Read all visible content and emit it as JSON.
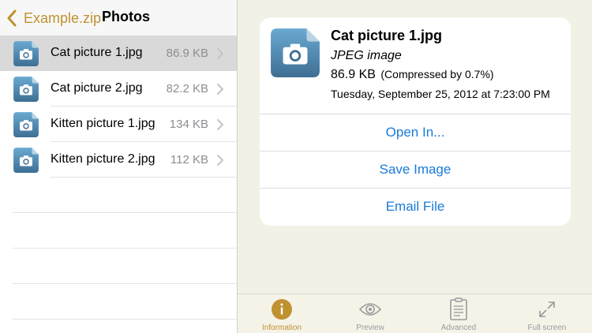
{
  "nav": {
    "back_label": "Example.zip",
    "title": "Photos"
  },
  "files": [
    {
      "name": "Cat picture 1.jpg",
      "size": "86.9 KB",
      "selected": true,
      "icon": "image-file-icon"
    },
    {
      "name": "Cat picture 2.jpg",
      "size": "82.2 KB",
      "selected": false,
      "icon": "image-file-icon"
    },
    {
      "name": "Kitten picture 1.jpg",
      "size": "134 KB",
      "selected": false,
      "icon": "image-file-icon"
    },
    {
      "name": "Kitten picture 2.jpg",
      "size": "112 KB",
      "selected": false,
      "icon": "image-file-icon"
    }
  ],
  "detail": {
    "name": "Cat picture 1.jpg",
    "type": "JPEG image",
    "size": "86.9 KB",
    "compressed": "(Compressed by 0.7%)",
    "date": "Tuesday, September 25, 2012 at 7:23:00 PM",
    "actions": [
      "Open In...",
      "Save Image",
      "Email File"
    ]
  },
  "tabs": [
    {
      "label": "Information",
      "icon": "info-icon",
      "active": true
    },
    {
      "label": "Preview",
      "icon": "eye-icon",
      "active": false
    },
    {
      "label": "Advanced",
      "icon": "clipboard-icon",
      "active": false
    },
    {
      "label": "Full screen",
      "icon": "expand-icon",
      "active": false
    }
  ],
  "colors": {
    "accent": "#c0912f",
    "link": "#1a7ad9",
    "selected_row": "#d9d9d9",
    "right_background": "#f2f1e6",
    "file_icon_top": "#6aa9d2",
    "file_icon_bottom": "#3e6f93"
  }
}
